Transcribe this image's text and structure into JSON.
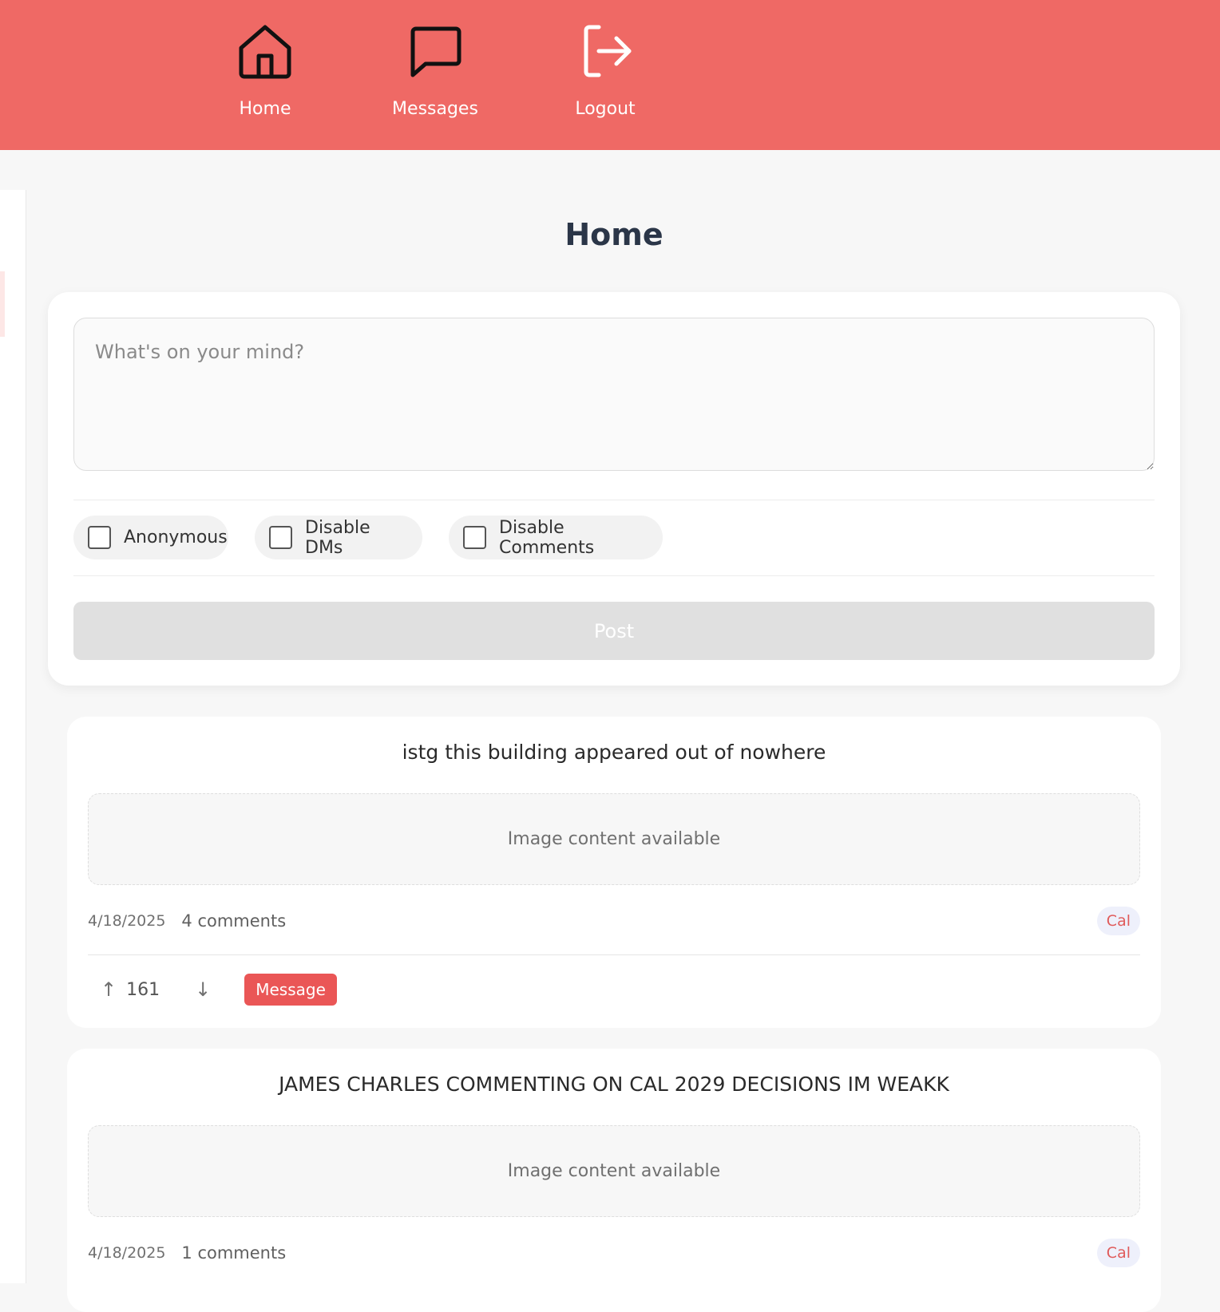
{
  "nav": {
    "items": [
      {
        "label": "Home",
        "icon": "home-icon"
      },
      {
        "label": "Messages",
        "icon": "message-bubble-icon"
      },
      {
        "label": "Logout",
        "icon": "logout-icon"
      }
    ]
  },
  "page": {
    "title": "Home"
  },
  "composer": {
    "placeholder": "What's on your mind?",
    "value": "",
    "options": [
      {
        "label": "Anonymous",
        "checked": false
      },
      {
        "label": "Disable DMs",
        "checked": false
      },
      {
        "label": "Disable Comments",
        "checked": false
      }
    ],
    "post_label": "Post"
  },
  "posts": [
    {
      "text": "istg this building appeared out of nowhere",
      "image_placeholder": "Image content available",
      "date": "4/18/2025",
      "comments": "4 comments",
      "tag": "Cal",
      "vote_up": "↑",
      "votes": "161",
      "vote_down": "↓",
      "message_label": "Message"
    },
    {
      "text": "JAMES CHARLES COMMENTING ON CAL 2029 DECISIONS IM WEAKK",
      "image_placeholder": "Image content available",
      "date": "4/18/2025",
      "comments": "1 comments",
      "tag": "Cal"
    }
  ],
  "colors": {
    "header": "#ef6965",
    "accent": "#ea5656",
    "tag_bg": "#eef0fb",
    "tag_text": "#e05b5b",
    "post_button_disabled": "#e0e0e0"
  }
}
